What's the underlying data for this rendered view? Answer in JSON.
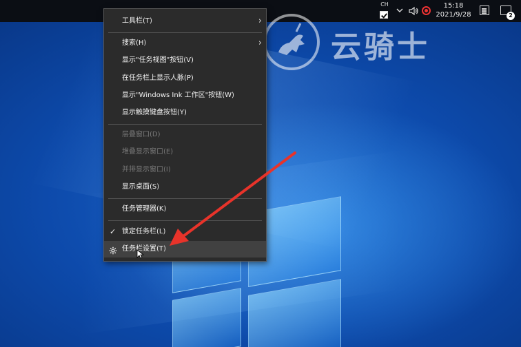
{
  "taskbar": {
    "lang": "CH",
    "time": "15:18",
    "date": "2021/9/28",
    "notification_count": "2"
  },
  "watermark": {
    "text": "云骑士"
  },
  "context_menu": {
    "items": [
      {
        "label": "工具栏(T)",
        "enabled": true,
        "submenu": true
      },
      {
        "label": "搜索(H)",
        "enabled": true,
        "submenu": true
      },
      {
        "label": "显示\"任务视图\"按钮(V)",
        "enabled": true
      },
      {
        "label": "在任务栏上显示人脉(P)",
        "enabled": true
      },
      {
        "label": "显示\"Windows Ink 工作区\"按钮(W)",
        "enabled": true
      },
      {
        "label": "显示触摸键盘按钮(Y)",
        "enabled": true
      },
      {
        "label": "层叠窗口(D)",
        "enabled": false
      },
      {
        "label": "堆叠显示窗口(E)",
        "enabled": false
      },
      {
        "label": "并排显示窗口(I)",
        "enabled": false
      },
      {
        "label": "显示桌面(S)",
        "enabled": true
      },
      {
        "label": "任务管理器(K)",
        "enabled": true
      },
      {
        "label": "锁定任务栏(L)",
        "enabled": true,
        "checked": true
      },
      {
        "label": "任务栏设置(T)",
        "enabled": true,
        "highlighted": true
      }
    ]
  },
  "colors": {
    "menu_bg": "#2b2b2b",
    "taskbar_bg": "#0b0e14",
    "arrow": "#e8332a",
    "record": "#e33333"
  }
}
